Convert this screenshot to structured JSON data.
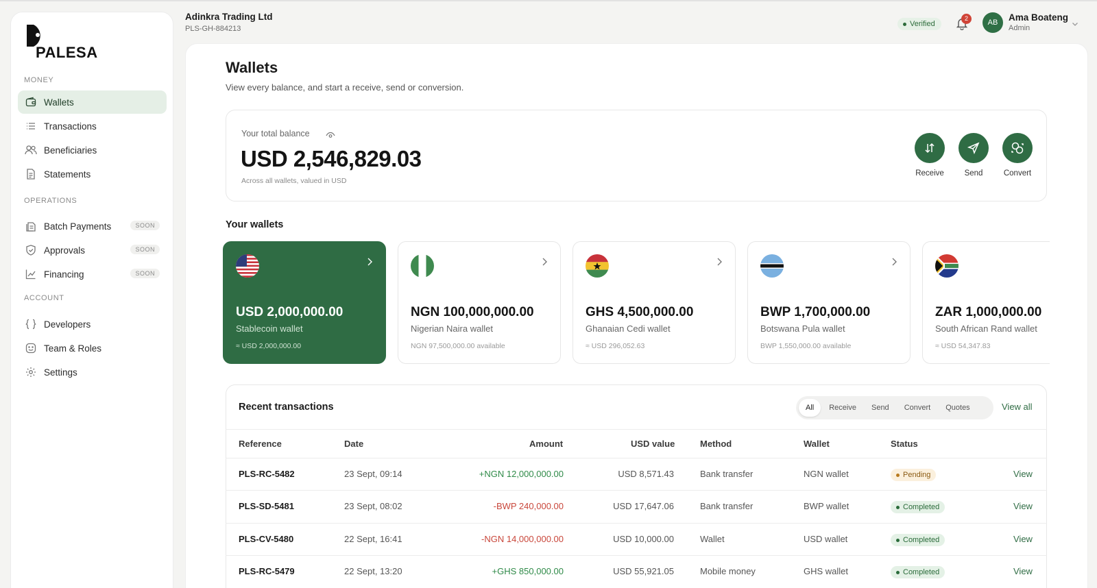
{
  "brand": {
    "name": "PALESA"
  },
  "sidebar": {
    "sections": [
      {
        "label": "MONEY"
      },
      {
        "label": "OPERATIONS"
      },
      {
        "label": "ACCOUNT"
      }
    ],
    "items": [
      {
        "label": "Wallets",
        "icon": "wallet-icon",
        "active": true
      },
      {
        "label": "Transactions",
        "icon": "list-icon"
      },
      {
        "label": "Beneficiaries",
        "icon": "users-icon"
      },
      {
        "label": "Statements",
        "icon": "document-icon"
      },
      {
        "label": "Batch Payments",
        "icon": "batch-icon",
        "badge": "SOON"
      },
      {
        "label": "Approvals",
        "icon": "shield-check-icon",
        "badge": "SOON"
      },
      {
        "label": "Financing",
        "icon": "chart-icon",
        "badge": "SOON"
      },
      {
        "label": "Developers",
        "icon": "braces-icon"
      },
      {
        "label": "Team & Roles",
        "icon": "smiley-icon"
      },
      {
        "label": "Settings",
        "icon": "gear-icon"
      }
    ]
  },
  "header": {
    "org_name": "Adinkra Trading Ltd",
    "org_id": "PLS-GH-884213",
    "verified": "Verified",
    "notifications": "2",
    "user": {
      "initials": "AB",
      "name": "Ama Boateng",
      "role": "Admin"
    }
  },
  "page": {
    "title": "Wallets",
    "subtitle": "View every balance, and start a receive, send or conversion."
  },
  "balance": {
    "label": "Your total balance",
    "amount": "USD 2,546,829.03",
    "note": "Across all wallets, valued in USD",
    "actions": [
      {
        "label": "Receive",
        "icon": "arrows-up-down-icon"
      },
      {
        "label": "Send",
        "icon": "send-icon"
      },
      {
        "label": "Convert",
        "icon": "convert-icon"
      }
    ]
  },
  "wallets": {
    "title": "Your wallets",
    "items": [
      {
        "amount": "USD 2,000,000.00",
        "name": "Stablecoin wallet",
        "sub": "≈ USD 2,000,000.00",
        "flag": "us-flag-icon"
      },
      {
        "amount": "NGN 100,000,000.00",
        "name": "Nigerian Naira wallet",
        "sub": "NGN 97,500,000.00 available",
        "flag": "ng-flag-icon"
      },
      {
        "amount": "GHS 4,500,000.00",
        "name": "Ghanaian Cedi wallet",
        "sub": "≈ USD 296,052.63",
        "flag": "gh-flag-icon"
      },
      {
        "amount": "BWP 1,700,000.00",
        "name": "Botswana Pula wallet",
        "sub": "BWP 1,550,000.00 available",
        "flag": "bw-flag-icon"
      },
      {
        "amount": "ZAR 1,000,000.00",
        "name": "South African Rand wallet",
        "sub": "≈ USD 54,347.83",
        "flag": "za-flag-icon"
      }
    ]
  },
  "transactions": {
    "title": "Recent transactions",
    "filters": [
      "All",
      "Receive",
      "Send",
      "Convert",
      "Quotes"
    ],
    "view_all": "View all",
    "columns": [
      "Reference",
      "Date",
      "Amount",
      "USD value",
      "Method",
      "Wallet",
      "Status"
    ],
    "rows": [
      {
        "ref": "PLS-RC-5482",
        "date": "23 Sept, 09:14",
        "amount": "+NGN 12,000,000.00",
        "usd": "USD 8,571.43",
        "method": "Bank transfer",
        "wallet": "NGN wallet",
        "status": "Pending",
        "action": "View"
      },
      {
        "ref": "PLS-SD-5481",
        "date": "23 Sept, 08:02",
        "amount": "-BWP 240,000.00",
        "usd": "USD 17,647.06",
        "method": "Bank transfer",
        "wallet": "BWP wallet",
        "status": "Completed",
        "action": "View"
      },
      {
        "ref": "PLS-CV-5480",
        "date": "22 Sept, 16:41",
        "amount": "-NGN 14,000,000.00",
        "usd": "USD 10,000.00",
        "method": "Wallet",
        "wallet": "USD wallet",
        "status": "Completed",
        "action": "View"
      },
      {
        "ref": "PLS-RC-5479",
        "date": "22 Sept, 13:20",
        "amount": "+GHS 850,000.00",
        "usd": "USD 55,921.05",
        "method": "Mobile money",
        "wallet": "GHS wallet",
        "status": "Completed",
        "action": "View"
      }
    ]
  },
  "colors": {
    "accent": "#2f6c44",
    "positive": "#2f8a48",
    "negative": "#c9473b"
  }
}
